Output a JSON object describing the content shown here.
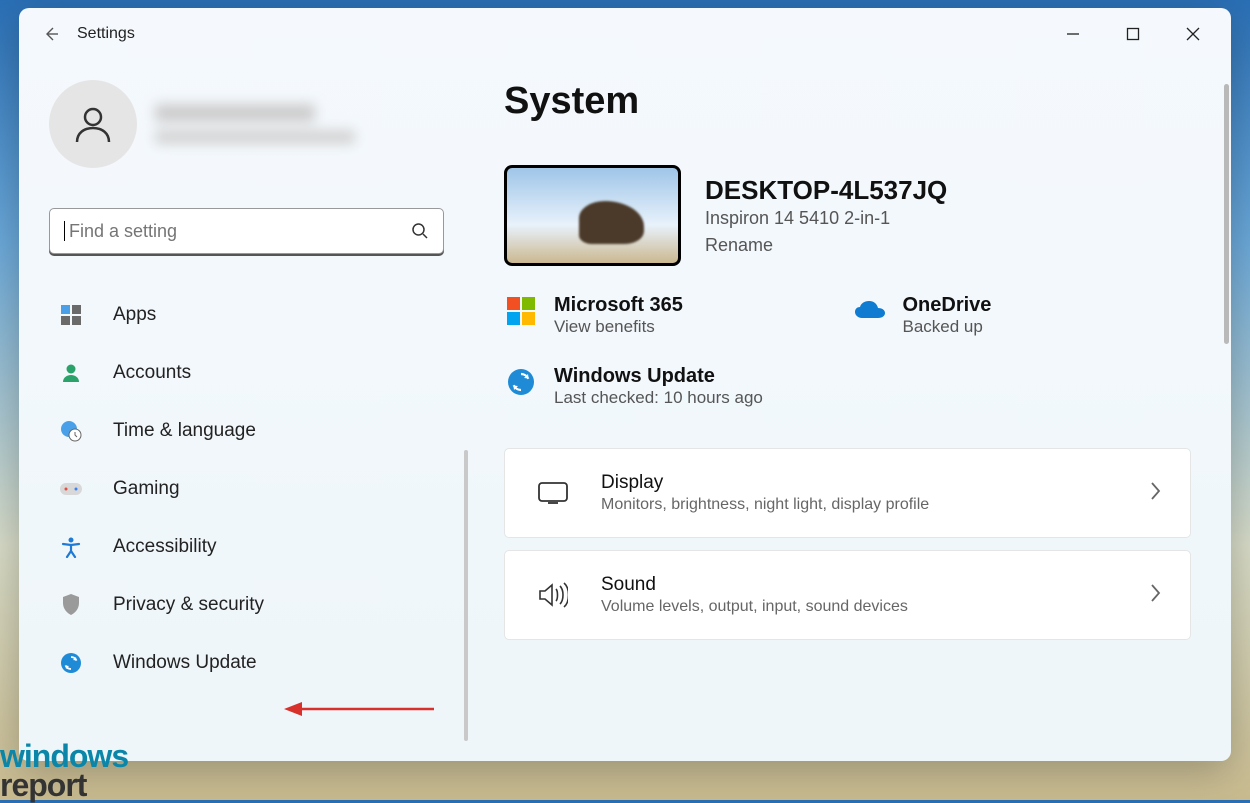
{
  "header": {
    "title": "Settings"
  },
  "search": {
    "placeholder": "Find a setting"
  },
  "sidebar": {
    "items": [
      {
        "label": "Apps"
      },
      {
        "label": "Accounts"
      },
      {
        "label": "Time & language"
      },
      {
        "label": "Gaming"
      },
      {
        "label": "Accessibility"
      },
      {
        "label": "Privacy & security"
      },
      {
        "label": "Windows Update"
      }
    ]
  },
  "page": {
    "title": "System"
  },
  "device": {
    "name": "DESKTOP-4L537JQ",
    "model": "Inspiron 14 5410 2-in-1",
    "rename_label": "Rename"
  },
  "status": {
    "m365": {
      "title": "Microsoft 365",
      "sub": "View benefits"
    },
    "onedrive": {
      "title": "OneDrive",
      "sub": "Backed up"
    },
    "update": {
      "title": "Windows Update",
      "sub": "Last checked: 10 hours ago"
    }
  },
  "cards": [
    {
      "title": "Display",
      "sub": "Monitors, brightness, night light, display profile"
    },
    {
      "title": "Sound",
      "sub": "Volume levels, output, input, sound devices"
    }
  ],
  "watermark": {
    "line1": "windows",
    "line2": "report"
  }
}
